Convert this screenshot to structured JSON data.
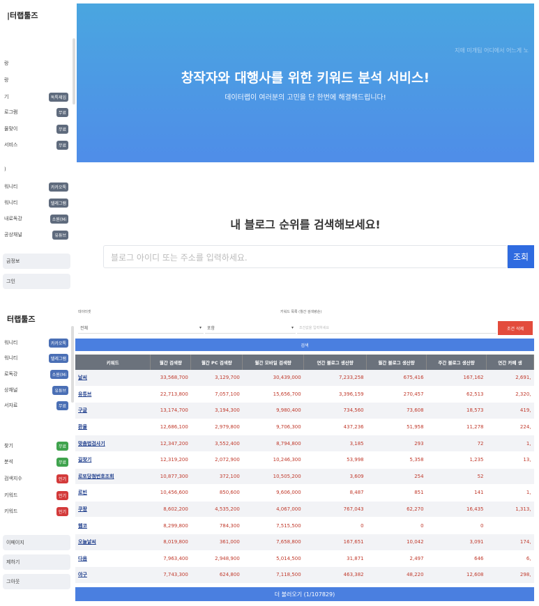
{
  "top": {
    "brand": "|터랩툴즈",
    "sidebar_items": [
      {
        "label": "랑",
        "badge": ""
      },
      {
        "label": "랑",
        "badge": ""
      },
      {
        "label": "기",
        "badge": "독특제임"
      },
      {
        "label": "로그램",
        "badge": "무료"
      },
      {
        "label": "물맞이",
        "badge": "무료"
      },
      {
        "label": "서비스",
        "badge": "무료"
      },
      {
        "label": ")",
        "badge": ""
      },
      {
        "label": "워니티",
        "badge": "카카오톡"
      },
      {
        "label": "워니티",
        "badge": "텔레그램"
      },
      {
        "label": "내로독강",
        "badge": "소원(Mi"
      },
      {
        "label": "공상채널",
        "badge": "유튜브"
      }
    ],
    "buttons": [
      "금정보",
      "그인"
    ],
    "hero": {
      "title": "창작자와 대행사를 위한 키워드 분석 서비스!",
      "subtitle": "데이터랩이 여러분의 고민을 단 한번에 해결해드립니다!",
      "faint": "지애 미개팀 어디에서 어느게 노"
    },
    "blog_search": {
      "title": "내 블로그 순위를 검색해보세요!",
      "placeholder": "블로그 아이디 또는 주소를 입력하세요.",
      "button": "조회"
    }
  },
  "bottom": {
    "brand": "터랩툴즈",
    "sidebar_items": [
      {
        "label": "워니티",
        "badge": "카카오톡",
        "color": "blue"
      },
      {
        "label": "워니티",
        "badge": "텔레그램",
        "color": "blue"
      },
      {
        "label": "로독강",
        "badge": "소원(Mi",
        "color": "blue"
      },
      {
        "label": "상채널",
        "badge": "유튜브",
        "color": "blue"
      },
      {
        "label": "서자료",
        "badge": "무료",
        "color": "blue"
      },
      {
        "label": "찾기",
        "badge": "무료",
        "color": "green"
      },
      {
        "label": "분석",
        "badge": "무료",
        "color": "green"
      },
      {
        "label": "검색지수",
        "badge": "인기",
        "color": "red"
      },
      {
        "label": "키워드",
        "badge": "인기",
        "color": "red"
      },
      {
        "label": "키워드",
        "badge": "인기",
        "color": "red"
      }
    ],
    "buttons": [
      "이페이지",
      "제하기",
      "그아웃"
    ],
    "filters": {
      "category_label": "데이터셋",
      "category_value": "전체",
      "type_value": "포함",
      "keyword_label": "키워드 목록 (월간 검색량순)",
      "keyword_placeholder": "조건값을 입력하세요",
      "reset_button": "조건 삭제",
      "search_button": "검색"
    },
    "table": {
      "headers": [
        "키워드",
        "월간 검색량",
        "월간 PC 검색량",
        "월간 모바일 검색량",
        "연간 블로그 생산량",
        "월간 블로그 생산량",
        "주간 블로그 생산량",
        "연간 카페 생"
      ],
      "rows": [
        [
          "날씨",
          "33,568,700",
          "3,129,700",
          "30,439,000",
          "7,233,258",
          "675,416",
          "167,162",
          "2,691,"
        ],
        [
          "유튜브",
          "22,713,800",
          "7,057,100",
          "15,656,700",
          "3,396,159",
          "270,457",
          "62,513",
          "2,320,"
        ],
        [
          "구글",
          "13,174,700",
          "3,194,300",
          "9,980,400",
          "734,560",
          "73,608",
          "18,573",
          "419,"
        ],
        [
          "환율",
          "12,686,100",
          "2,979,800",
          "9,706,300",
          "437,236",
          "51,958",
          "11,278",
          "224,"
        ],
        [
          "맞춤법검사기",
          "12,347,200",
          "3,552,400",
          "8,794,800",
          "3,185",
          "293",
          "72",
          "1,"
        ],
        [
          "길찾기",
          "12,319,200",
          "2,072,900",
          "10,246,300",
          "53,998",
          "5,358",
          "1,235",
          "13,"
        ],
        [
          "로또당첨번호조회",
          "10,877,300",
          "372,100",
          "10,505,200",
          "3,609",
          "254",
          "52",
          ""
        ],
        [
          "로빈",
          "10,456,600",
          "850,600",
          "9,606,000",
          "8,487",
          "851",
          "141",
          "1,"
        ],
        [
          "쿠팡",
          "8,602,200",
          "4,535,200",
          "4,067,000",
          "767,043",
          "62,270",
          "16,435",
          "1,313,"
        ],
        [
          "웹코",
          "8,299,800",
          "784,300",
          "7,515,500",
          "0",
          "0",
          "0",
          ""
        ],
        [
          "오늘날씨",
          "8,019,800",
          "361,000",
          "7,658,800",
          "167,651",
          "10,042",
          "3,091",
          "174,"
        ],
        [
          "다음",
          "7,963,400",
          "2,948,900",
          "5,014,500",
          "31,871",
          "2,497",
          "646",
          "6,"
        ],
        [
          "야구",
          "7,743,300",
          "624,800",
          "7,118,500",
          "463,382",
          "48,220",
          "12,608",
          "298,"
        ]
      ]
    },
    "more_button": "더 불러오기 (1/107829)"
  }
}
